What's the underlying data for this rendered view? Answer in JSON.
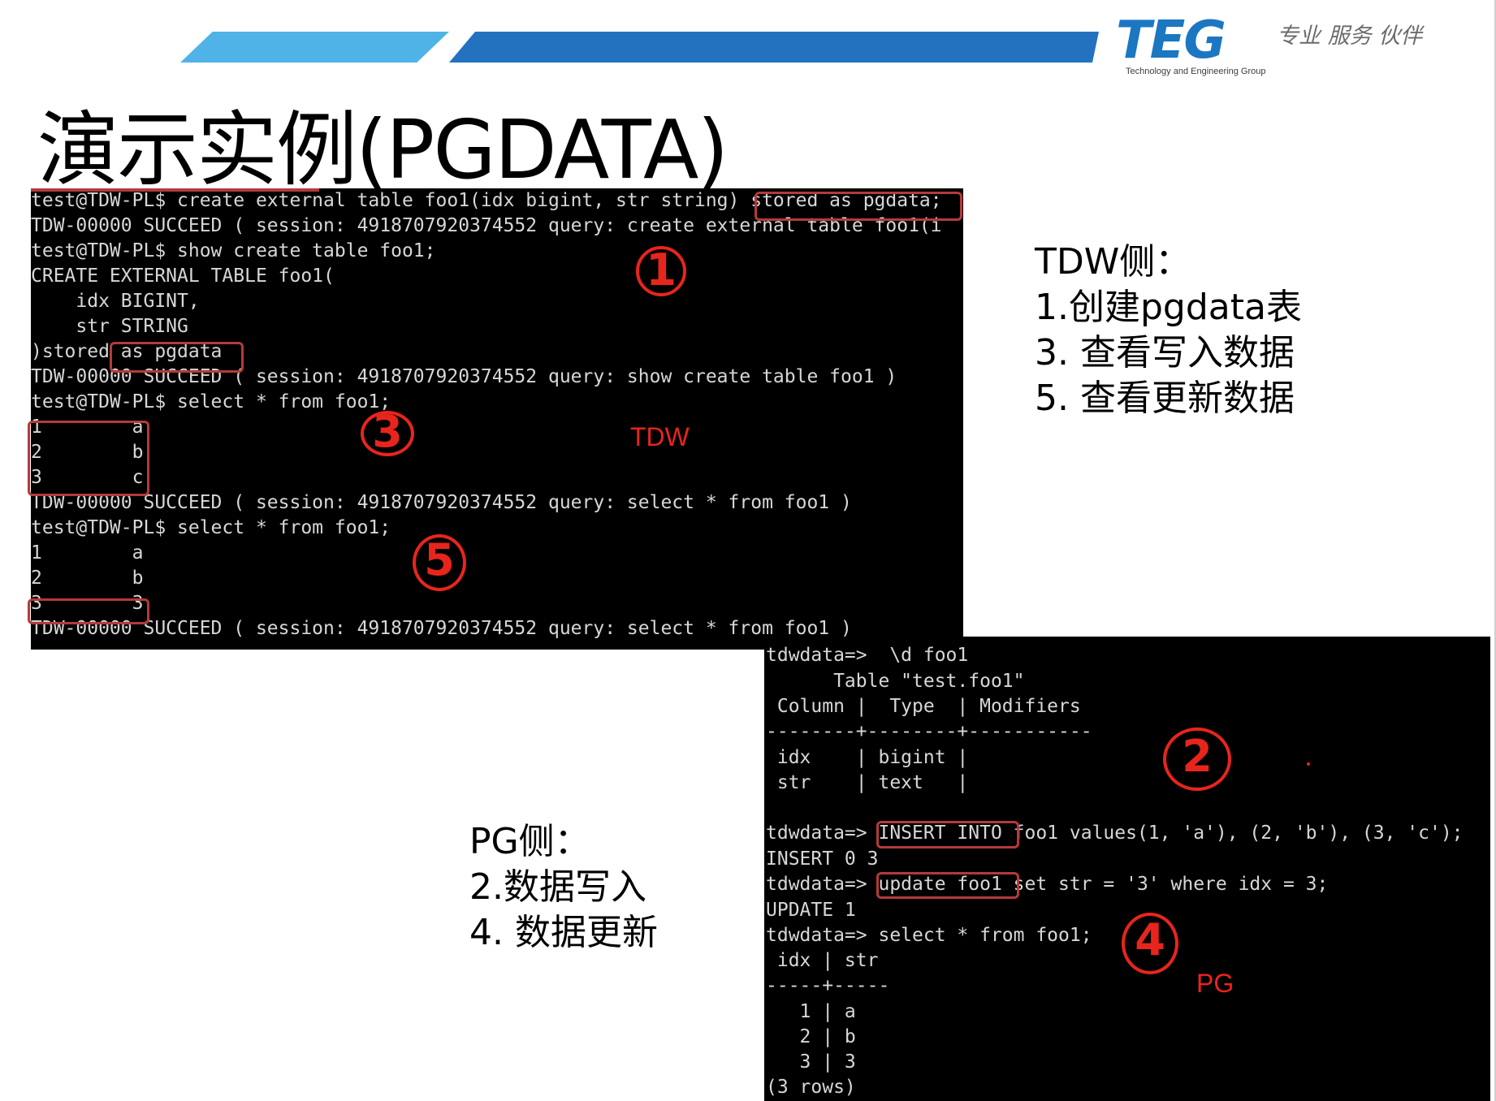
{
  "header": {
    "logo": "TEG",
    "tagline": "专业 服务 伙伴",
    "subtitle": "Technology and Engineering Group"
  },
  "title": "演示实例(PGDATA)",
  "tdw_terminal": {
    "lines": [
      "test@TDW-PL$ create external table foo1(idx bigint, str string) stored as pgdata;",
      "TDW-00000 SUCCEED ( session: 4918707920374552 query: create external table foo1(i",
      "test@TDW-PL$ show create table foo1;",
      "CREATE EXTERNAL TABLE foo1(",
      "    idx BIGINT,",
      "    str STRING",
      ")stored as pgdata",
      "TDW-00000 SUCCEED ( session: 4918707920374552 query: show create table foo1 )",
      "test@TDW-PL$ select * from foo1;",
      "1        a",
      "2        b",
      "3        c",
      "TDW-00000 SUCCEED ( session: 4918707920374552 query: select * from foo1 )",
      "test@TDW-PL$ select * from foo1;",
      "1        a",
      "2        b",
      "3        3",
      "TDW-00000 SUCCEED ( session: 4918707920374552 query: select * from foo1 )"
    ],
    "label": "TDW",
    "steps": [
      "1",
      "3",
      "5"
    ]
  },
  "pg_terminal": {
    "lines": [
      "tdwdata=>  \\d foo1",
      "      Table \"test.foo1\"",
      " Column |  Type  | Modifiers",
      "--------+--------+-----------",
      " idx    | bigint |",
      " str    | text   |",
      "",
      "tdwdata=> INSERT INTO foo1 values(1, 'a'), (2, 'b'), (3, 'c');",
      "INSERT 0 3",
      "tdwdata=> update foo1 set str = '3' where idx = 3;",
      "UPDATE 1",
      "tdwdata=> select * from foo1;",
      " idx | str",
      "-----+-----",
      "   1 | a",
      "   2 | b",
      "   3 | 3",
      "(3 rows)"
    ],
    "label": "PG",
    "steps": [
      "2",
      "4"
    ]
  },
  "notes": {
    "tdw": [
      "TDW侧：",
      "1.创建pgdata表",
      "3. 查看写入数据",
      "5. 查看更新数据"
    ],
    "pg": [
      "PG侧：",
      "2.数据写入",
      "4. 数据更新"
    ]
  },
  "colors": {
    "band_light": "#4fb3e8",
    "band_dark": "#2372c0",
    "logo_blue": "#1c77c2",
    "annotation_red": "#e8251c",
    "highlight_box": "#b53a3a",
    "terminal_bg": "#000000",
    "terminal_text": "#d7d7d7"
  }
}
